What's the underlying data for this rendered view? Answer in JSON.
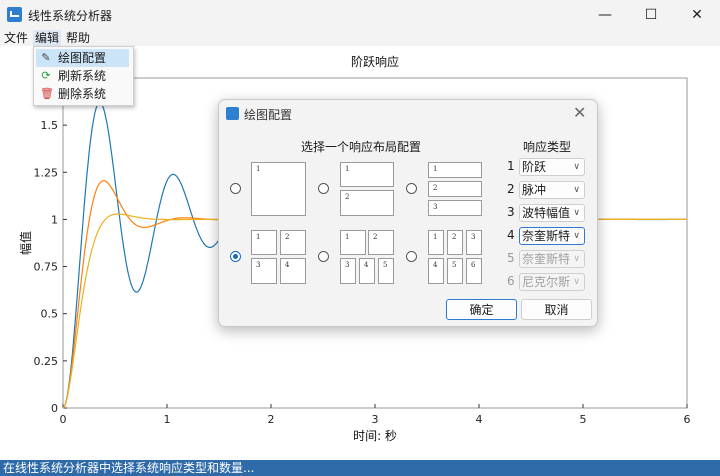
{
  "window": {
    "title": "线性系统分析器",
    "minimize": "—",
    "maximize": "☐",
    "close": "✕"
  },
  "menubar": [
    "文件",
    "编辑",
    "帮助"
  ],
  "edit_menu": [
    {
      "label": "绘图配置",
      "icon": "plot-config-icon"
    },
    {
      "label": "刷新系统",
      "icon": "refresh-icon"
    },
    {
      "label": "删除系统",
      "icon": "trash-icon"
    }
  ],
  "chart_data": {
    "type": "line",
    "title": "阶跃响应",
    "xlabel": "时间: 秒",
    "ylabel": "幅值",
    "xlim": [
      0,
      6
    ],
    "ylim": [
      0,
      1.75
    ],
    "xticks": [
      "0",
      "1",
      "2",
      "3",
      "4",
      "5",
      "6"
    ],
    "yticks": [
      "0",
      "0.25",
      "0.5",
      "0.75",
      "1",
      "1.25",
      "1.5"
    ],
    "series": [
      {
        "zeta": 0.15,
        "wn": 9.0,
        "color": "#1f77b4"
      },
      {
        "zeta": 0.45,
        "wn": 9.0,
        "color": "#ff7f0e"
      },
      {
        "zeta": 0.75,
        "wn": 9.0,
        "color": "#edb120"
      }
    ]
  },
  "dialog": {
    "title": "绘图配置",
    "close": "✕",
    "layout_section_title": "选择一个响应布局配置",
    "types_section_title": "响应类型",
    "layouts": [
      {
        "cells": [
          "1"
        ],
        "selected": false
      },
      {
        "cells": [
          "1",
          "2"
        ],
        "selected": false
      },
      {
        "cells": [
          "1",
          "2",
          "3"
        ],
        "selected": false
      },
      {
        "cells": [
          "1",
          "2",
          "3",
          "4"
        ],
        "selected": true
      },
      {
        "cells": [
          "1",
          "2",
          "3",
          "4",
          "5"
        ],
        "selected": false
      },
      {
        "cells": [
          "1",
          "2",
          "3",
          "4",
          "5",
          "6"
        ],
        "selected": false
      }
    ],
    "response_types": [
      {
        "index": "1",
        "value": "阶跃",
        "disabled": false,
        "focus": false
      },
      {
        "index": "2",
        "value": "脉冲",
        "disabled": false,
        "focus": false
      },
      {
        "index": "3",
        "value": "波特幅值",
        "disabled": false,
        "focus": false
      },
      {
        "index": "4",
        "value": "奈奎斯特",
        "disabled": false,
        "focus": true
      },
      {
        "index": "5",
        "value": "奈奎斯特",
        "disabled": true,
        "focus": false
      },
      {
        "index": "6",
        "value": "尼克尔斯",
        "disabled": true,
        "focus": false
      }
    ],
    "ok_label": "确定",
    "cancel_label": "取消"
  },
  "status": "在线性系统分析器中选择系统响应类型和数量..."
}
